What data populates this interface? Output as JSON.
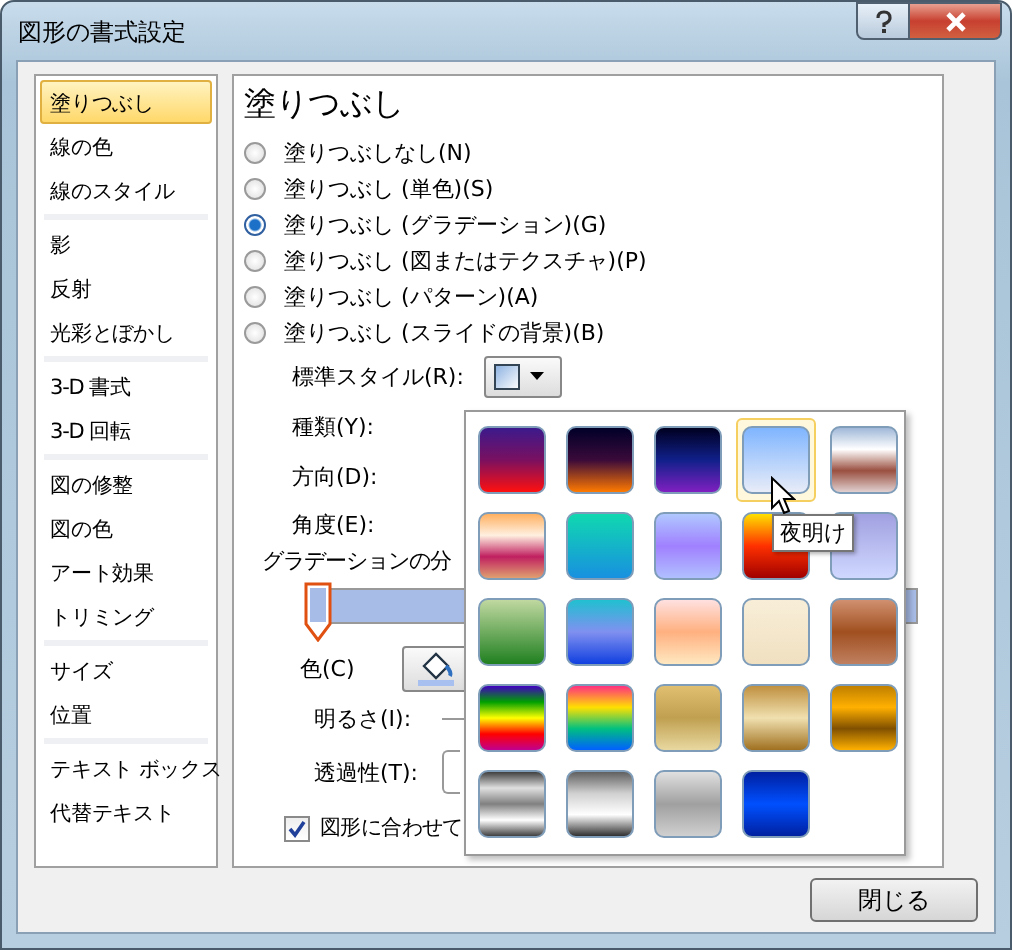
{
  "window": {
    "title": "図形の書式設定"
  },
  "sidebar": {
    "groups": [
      {
        "items": [
          {
            "label": "塗りつぶし",
            "selected": true
          },
          {
            "label": "線の色",
            "selected": false
          },
          {
            "label": "線のスタイル",
            "selected": false
          }
        ]
      },
      {
        "items": [
          {
            "label": "影",
            "selected": false
          },
          {
            "label": "反射",
            "selected": false
          },
          {
            "label": "光彩とぼかし",
            "selected": false
          }
        ]
      },
      {
        "items": [
          {
            "label": "3-D 書式",
            "selected": false
          },
          {
            "label": "3-D 回転",
            "selected": false
          }
        ]
      },
      {
        "items": [
          {
            "label": "図の修整",
            "selected": false
          },
          {
            "label": "図の色",
            "selected": false
          },
          {
            "label": "アート効果",
            "selected": false
          },
          {
            "label": "トリミング",
            "selected": false
          }
        ]
      },
      {
        "items": [
          {
            "label": "サイズ",
            "selected": false
          },
          {
            "label": "位置",
            "selected": false
          }
        ]
      },
      {
        "items": [
          {
            "label": "テキスト ボックス",
            "selected": false
          },
          {
            "label": "代替テキスト",
            "selected": false
          }
        ]
      }
    ]
  },
  "fill": {
    "heading": "塗りつぶし",
    "options": [
      {
        "label": "塗りつぶしなし(N)",
        "selected": false
      },
      {
        "label": "塗りつぶし (単色)(S)",
        "selected": false
      },
      {
        "label": "塗りつぶし (グラデーション)(G)",
        "selected": true
      },
      {
        "label": "塗りつぶし (図またはテクスチャ)(P)",
        "selected": false
      },
      {
        "label": "塗りつぶし (パターン)(A)",
        "selected": false
      },
      {
        "label": "塗りつぶし (スライドの背景)(B)",
        "selected": false
      }
    ],
    "preset_label": "標準スタイル(R):",
    "type_label": "種類(Y):",
    "direction_label": "方向(D):",
    "angle_label": "角度(E):",
    "stops_label": "グラデーションの分",
    "stop_slider": {
      "level": 0
    },
    "color_label": "色(C)",
    "brightness_label": "明るさ(I):",
    "transparency_label": "透過性(T):",
    "rotate_checkbox": {
      "label": "図形に合わせて",
      "checked": true
    }
  },
  "gallery": {
    "tooltip": "夜明け",
    "swatches": [
      {
        "selected": false
      },
      {
        "selected": false
      },
      {
        "selected": false
      },
      {
        "selected": true
      },
      {
        "selected": false
      },
      {
        "selected": false
      },
      {
        "selected": false
      },
      {
        "selected": false
      },
      {
        "selected": false
      },
      {
        "selected": false
      },
      {
        "selected": false
      },
      {
        "selected": false
      },
      {
        "selected": false
      },
      {
        "selected": false
      },
      {
        "selected": false
      },
      {
        "selected": false
      },
      {
        "selected": false
      },
      {
        "selected": false
      },
      {
        "selected": false
      },
      {
        "selected": false
      },
      {
        "selected": false
      },
      {
        "selected": false
      },
      {
        "selected": false
      },
      {
        "selected": false
      }
    ]
  },
  "buttons": {
    "close": "閉じる"
  }
}
